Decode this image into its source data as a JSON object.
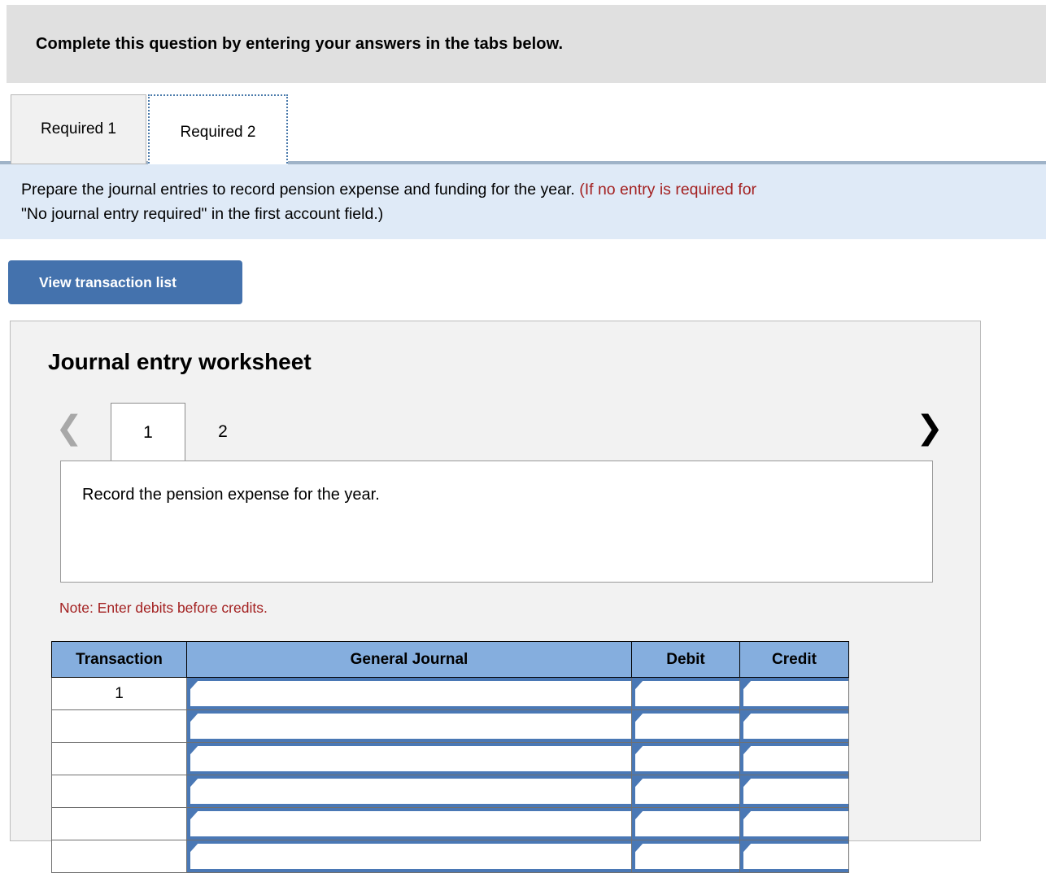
{
  "top_banner": {
    "text": "Complete this question by entering your answers in the tabs below."
  },
  "required_tabs": {
    "items": [
      {
        "label": "Required 1",
        "active": false
      },
      {
        "label": "Required 2",
        "active": true
      }
    ]
  },
  "requirement_banner": {
    "line1_black": "Prepare the journal entries to record pension expense and funding for the year. ",
    "line1_red": "(If no entry is required for",
    "line2_red": "\"No journal entry required\" in the first account field.)"
  },
  "toolbar": {
    "view_transaction_list_label": "View transaction list"
  },
  "worksheet": {
    "title": "Journal entry worksheet",
    "pager": {
      "prev_icon": "chevron-left-icon",
      "next_icon": "chevron-right-icon",
      "tabs": [
        {
          "label": "1",
          "active": true
        },
        {
          "label": "2",
          "active": false
        }
      ]
    },
    "description": "Record the pension expense for the year.",
    "note": "Note: Enter debits before credits.",
    "table": {
      "columns": [
        "Transaction",
        "General Journal",
        "Debit",
        "Credit"
      ],
      "rows": [
        {
          "transaction": "1",
          "general_journal": "",
          "debit": "",
          "credit": ""
        },
        {
          "transaction": "",
          "general_journal": "",
          "debit": "",
          "credit": ""
        },
        {
          "transaction": "",
          "general_journal": "",
          "debit": "",
          "credit": ""
        },
        {
          "transaction": "",
          "general_journal": "",
          "debit": "",
          "credit": ""
        },
        {
          "transaction": "",
          "general_journal": "",
          "debit": "",
          "credit": ""
        },
        {
          "transaction": "",
          "general_journal": "",
          "debit": "",
          "credit": ""
        }
      ]
    }
  },
  "colors": {
    "banner_gray": "#e0e0e0",
    "banner_blue": "#dfeaf7",
    "accent_blue": "#4472ad",
    "header_blue": "#85aede",
    "field_blue": "#4a78b5",
    "alert_red": "#a32020",
    "panel_gray": "#f2f2f2"
  }
}
